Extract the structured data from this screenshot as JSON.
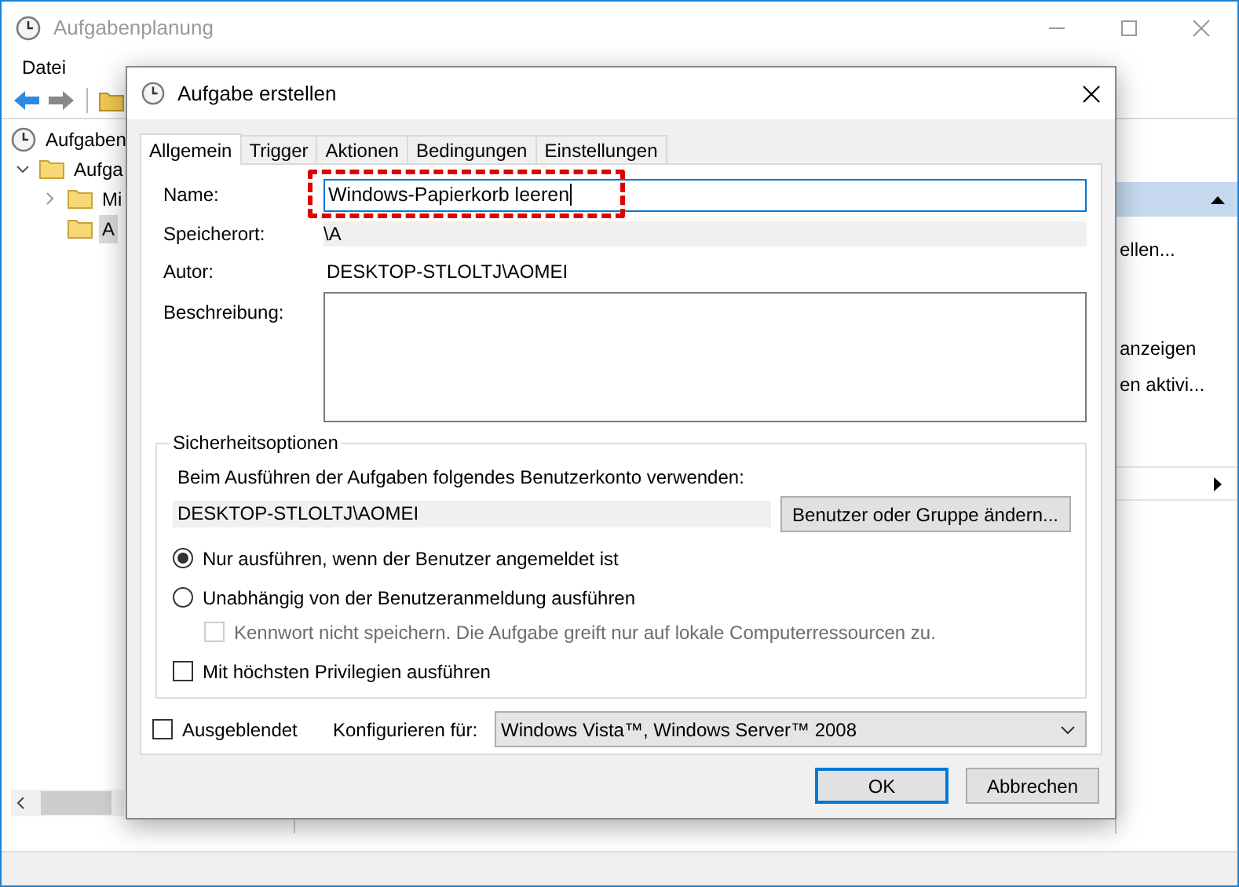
{
  "window": {
    "title": "Aufgabenplanung"
  },
  "menu": [
    "Datei"
  ],
  "tree": [
    {
      "label": "Aufgaben",
      "selected": false,
      "children": [
        {
          "label": "Aufga",
          "selected": false,
          "expanded": true,
          "children": [
            {
              "label": "Mi",
              "selected": false,
              "expanded": false
            },
            {
              "label": "A",
              "selected": true
            }
          ]
        }
      ]
    }
  ],
  "actions": {
    "items": [
      {
        "label": "ellen...",
        "kind": "text"
      },
      {
        "label": "anzeigen",
        "kind": "text"
      },
      {
        "label": "en aktivi...",
        "kind": "text"
      },
      {
        "kind": "submenu"
      }
    ]
  },
  "dialog": {
    "title": "Aufgabe erstellen",
    "tabs": [
      {
        "label": "Allgemein",
        "selected": true
      },
      {
        "label": "Trigger",
        "selected": false
      },
      {
        "label": "Aktionen",
        "selected": false
      },
      {
        "label": "Bedingungen",
        "selected": false
      },
      {
        "label": "Einstellungen",
        "selected": false
      }
    ],
    "name": {
      "label": "Name:",
      "value": "Windows-Papierkorb leeren",
      "highlighted": true
    },
    "location": {
      "label": "Speicherort:",
      "value": "\\A"
    },
    "author": {
      "label": "Autor:",
      "value": "DESKTOP-STLOLTJ\\AOMEI"
    },
    "description": {
      "label": "Beschreibung:"
    },
    "security": {
      "title": "Sicherheitsoptionen",
      "prompt": "Beim Ausführen der Aufgaben folgendes Benutzerkonto verwenden:",
      "account": "DESKTOP-STLOLTJ\\AOMEI",
      "change_button": "Benutzer oder Gruppe ändern...",
      "options": [
        {
          "kind": "radio",
          "label": "Nur ausführen, wenn der Benutzer angemeldet ist",
          "selected": true
        },
        {
          "kind": "radio",
          "label": "Unabhängig von der Benutzeranmeldung ausführen",
          "selected": false
        },
        {
          "kind": "checkbox",
          "label": "Kennwort nicht speichern. Die Aufgabe greift nur auf lokale Computerressourcen zu.",
          "checked": false,
          "disabled": true
        },
        {
          "kind": "checkbox",
          "label": "Mit höchsten Privilegien ausführen",
          "checked": false,
          "disabled": false
        }
      ]
    },
    "hidden": {
      "label": "Ausgeblendet",
      "checked": false
    },
    "configure": {
      "label": "Konfigurieren für:",
      "value": "Windows Vista™, Windows Server™ 2008"
    },
    "buttons": [
      {
        "label": "OK",
        "default": true
      },
      {
        "label": "Abbrechen",
        "default": false
      }
    ]
  }
}
